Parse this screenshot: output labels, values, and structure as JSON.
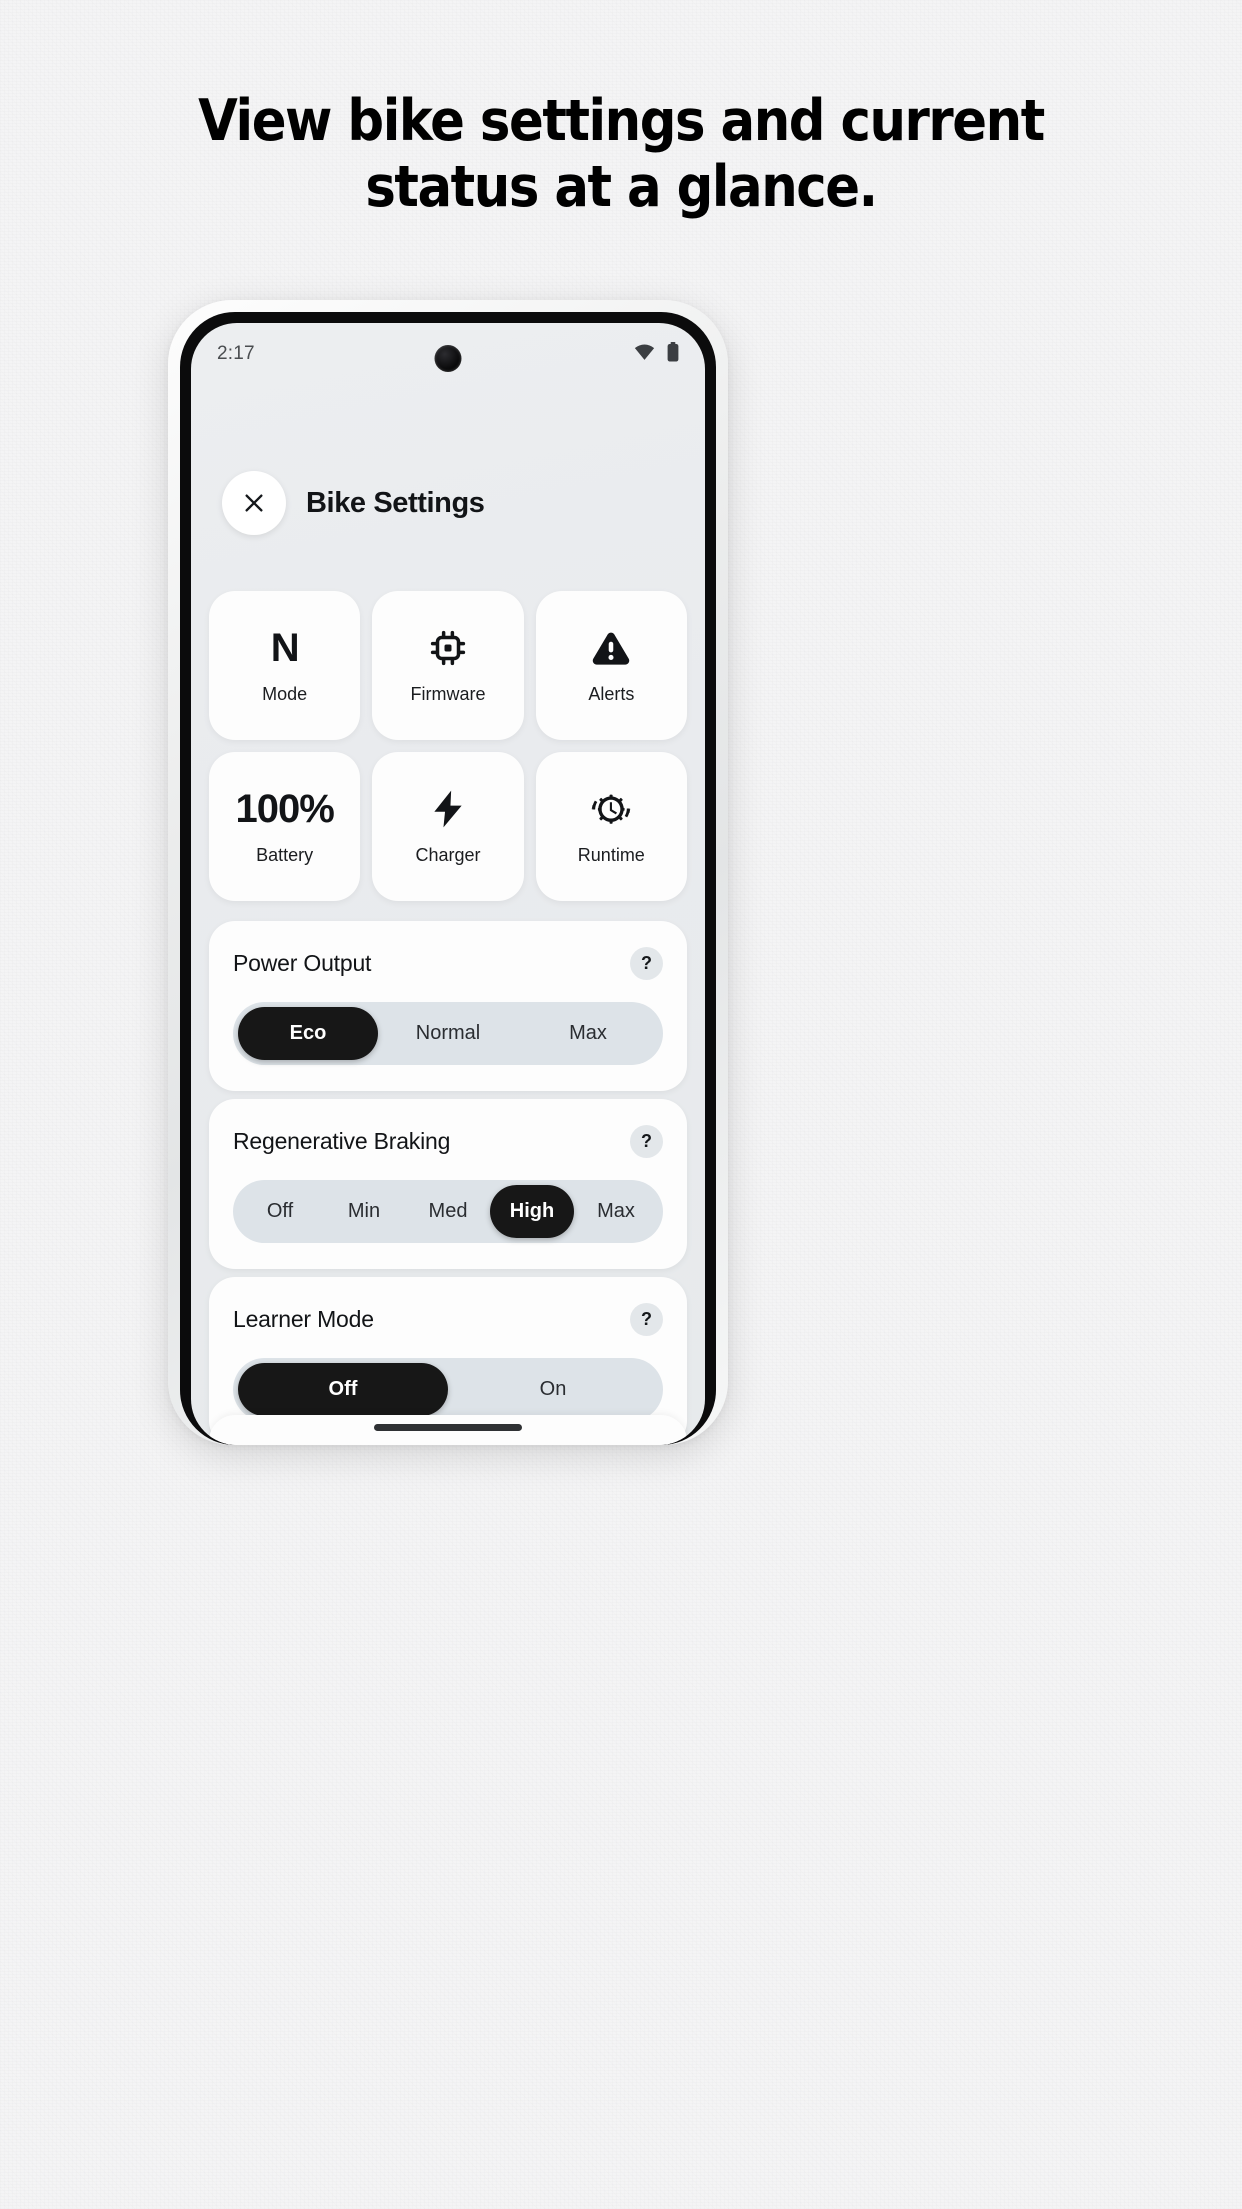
{
  "headline": {
    "line1": "View bike settings and current",
    "line2": "status at a glance."
  },
  "phone": {
    "status_bar": {
      "time": "2:17",
      "wifi_icon": "wifi-icon",
      "battery_icon": "battery-icon"
    },
    "header": {
      "close_icon": "close-icon",
      "title": "Bike Settings"
    },
    "tiles": [
      {
        "glyph": "N",
        "icon": null,
        "label": "Mode"
      },
      {
        "glyph": null,
        "icon": "chip-icon",
        "label": "Firmware"
      },
      {
        "glyph": null,
        "icon": "warning-icon",
        "label": "Alerts"
      },
      {
        "glyph": "100%",
        "icon": null,
        "label": "Battery"
      },
      {
        "glyph": null,
        "icon": "bolt-icon",
        "label": "Charger"
      },
      {
        "glyph": null,
        "icon": "runtime-icon",
        "label": "Runtime"
      }
    ],
    "settings": [
      {
        "title": "Power Output",
        "help_label": "?",
        "options": [
          "Eco",
          "Normal",
          "Max"
        ],
        "selected": "Eco"
      },
      {
        "title": "Regenerative Braking",
        "help_label": "?",
        "options": [
          "Off",
          "Min",
          "Med",
          "High",
          "Max"
        ],
        "selected": "High"
      },
      {
        "title": "Learner Mode",
        "help_label": "?",
        "options": [
          "Off",
          "On"
        ],
        "selected": "Off"
      }
    ]
  },
  "colors": {
    "page_bg": "#f4f4f5",
    "screen_bg": "#e9ebee",
    "card_bg": "#fdfdfd",
    "segment_track": "#dde3e8",
    "segment_selected": "#171717",
    "text_primary": "#121417"
  }
}
